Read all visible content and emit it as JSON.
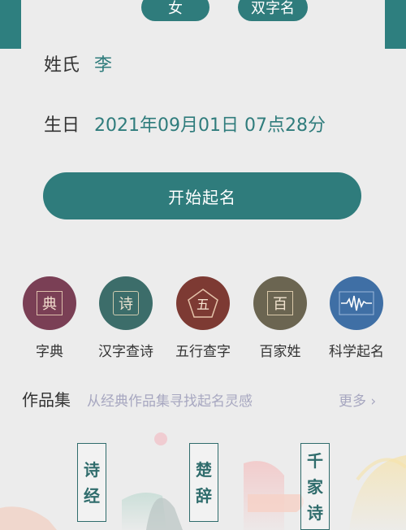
{
  "selectors": {
    "gender": "女",
    "name_type": "双字名"
  },
  "form": {
    "surname_label": "姓氏",
    "surname_value": "李",
    "birthday_label": "生日",
    "birthday_value": "2021年09月01日 07点28分"
  },
  "start_button": "开始起名",
  "tools": [
    {
      "label": "字典",
      "glyph": "典",
      "icon": "dictionary-icon",
      "color": "#7a3f55"
    },
    {
      "label": "汉字查诗",
      "glyph": "诗",
      "icon": "poem-scroll-icon",
      "color": "#3c6d6a"
    },
    {
      "label": "五行查字",
      "glyph": "五",
      "icon": "five-elements-icon",
      "color": "#7d3a33"
    },
    {
      "label": "百家姓",
      "glyph": "百",
      "icon": "surname-scroll-icon",
      "color": "#6b6551"
    },
    {
      "label": "科学起名",
      "glyph": "",
      "icon": "waveform-icon",
      "color": "#3f6fa5"
    }
  ],
  "works": {
    "title": "作品集",
    "subtitle": "从经典作品集寻找起名灵感",
    "more": "更多 ›",
    "books": [
      {
        "chars": [
          "诗",
          "经"
        ]
      },
      {
        "chars": [
          "楚",
          "辞"
        ]
      },
      {
        "chars": [
          "千",
          "家",
          "诗"
        ]
      }
    ]
  }
}
